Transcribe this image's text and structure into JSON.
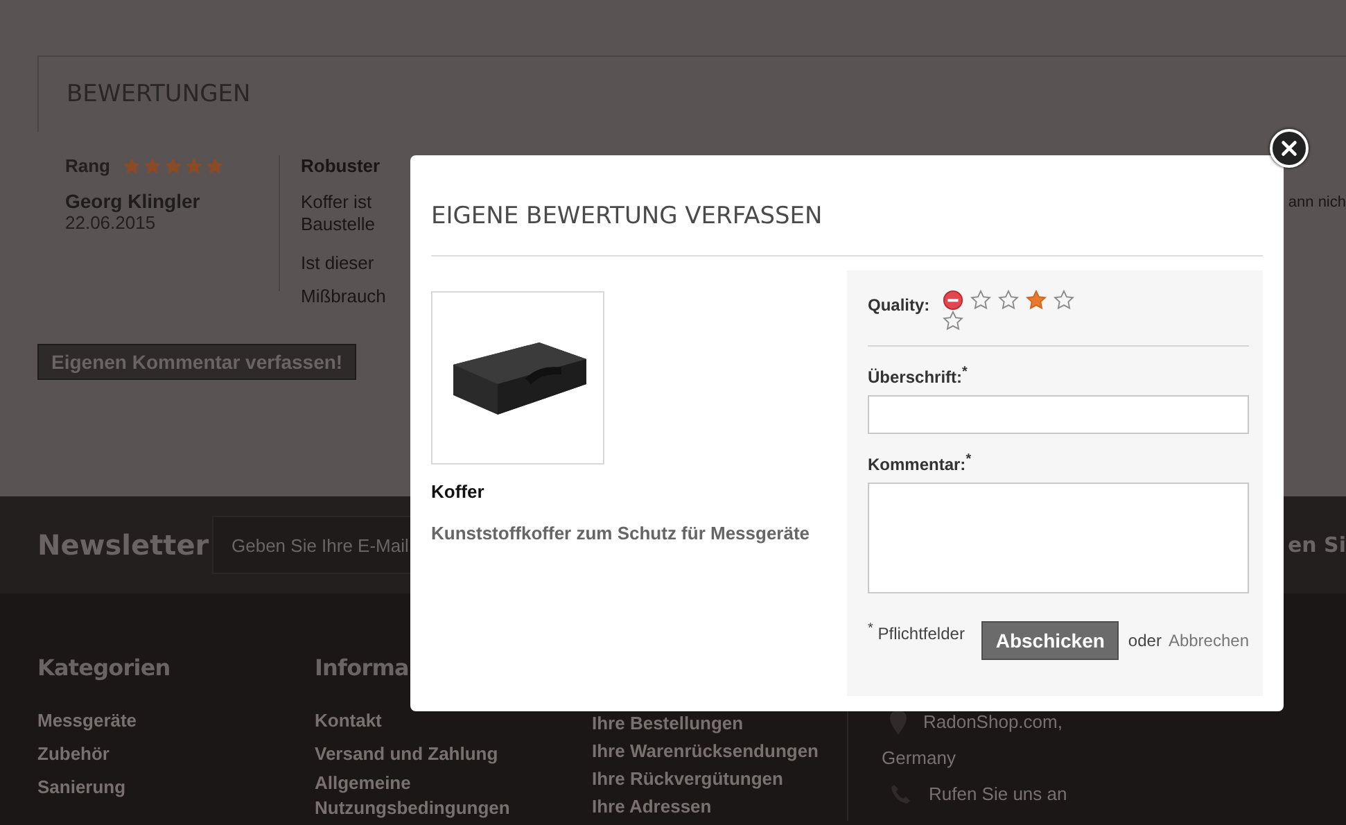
{
  "reviews_section": {
    "title": "BEWERTUNGEN",
    "review": {
      "rank_label": "Rang",
      "stars": 5,
      "author": "Georg Klingler",
      "date": "22.06.2015",
      "title": "Robuster",
      "lines": [
        "Koffer ist",
        "Baustelle"
      ],
      "helpful_question": "Ist dieser",
      "report_link": "Mißbrauch",
      "right_fragment": "ann nich"
    },
    "write_button": "Eigenen Kommentar verfassen!"
  },
  "newsletter": {
    "title": "Newsletter",
    "placeholder": "Geben Sie Ihre E-Mail",
    "right_fragment": "en Si"
  },
  "footer": {
    "columns": [
      {
        "title": "Kategorien",
        "links": [
          "Messgeräte",
          "Zubehör",
          "Sanierung"
        ]
      },
      {
        "title": "Informa",
        "links": [
          "Kontakt",
          "Versand und Zahlung",
          "Allgemeine Nutzungsbedingungen"
        ]
      },
      {
        "links": [
          "Ihre Bestellungen",
          "Ihre Warenrücksendungen",
          "Ihre Rückvergütungen",
          "Ihre Adressen"
        ]
      }
    ],
    "contact": {
      "address_lines": [
        "RadonShop.com,",
        "Germany"
      ],
      "phone": "Rufen Sie uns an"
    }
  },
  "modal": {
    "title": "EIGENE BEWERTUNG VERFASSEN",
    "product": {
      "name": "Koffer",
      "description": "Kunststoffkoffer zum Schutz für Messgeräte"
    },
    "form": {
      "quality_label": "Quality:",
      "rating_options": [
        {
          "kind": "cancel",
          "selected": false
        },
        {
          "kind": "star",
          "selected": false
        },
        {
          "kind": "star",
          "selected": false
        },
        {
          "kind": "star",
          "selected": true
        },
        {
          "kind": "star",
          "selected": false
        },
        {
          "kind": "star",
          "selected": false
        }
      ],
      "fields": [
        {
          "kind": "input",
          "label": "Überschrift:$^{*}$"
        },
        {
          "kind": "textarea",
          "label": "Kommentar:$^{*}$"
        }
      ],
      "required_note": "$^{*}$ Pflichtfelder",
      "submit": "Abschicken",
      "or": "oder",
      "cancel": "Abbrechen"
    }
  }
}
